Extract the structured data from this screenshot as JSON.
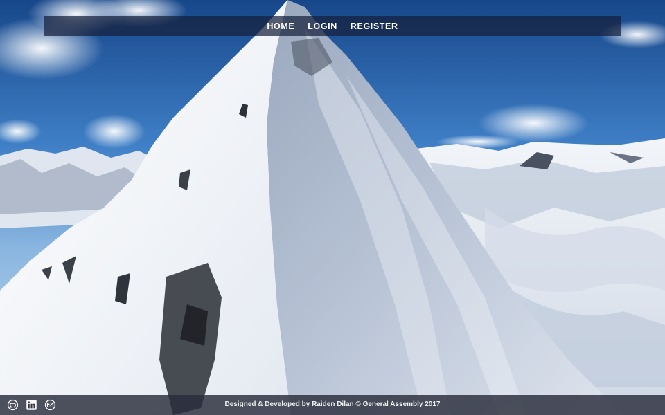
{
  "nav": {
    "items": [
      {
        "label": "HOME"
      },
      {
        "label": "LOGIN"
      },
      {
        "label": "REGISTER"
      }
    ]
  },
  "footer": {
    "credit": "Designed & Developed by Raiden Dilan © General Assembly 2017",
    "social": [
      {
        "icon": "github-icon"
      },
      {
        "icon": "linkedin-icon"
      },
      {
        "icon": "email-icon"
      }
    ]
  },
  "colors": {
    "sky_top": "#1d4f92",
    "sky_mid": "#6aa4dc",
    "snow": "#f4f6fa",
    "shadow": "#8f9fb8",
    "nav_bg": "#16203c",
    "footer_bg": "#282c3a"
  }
}
